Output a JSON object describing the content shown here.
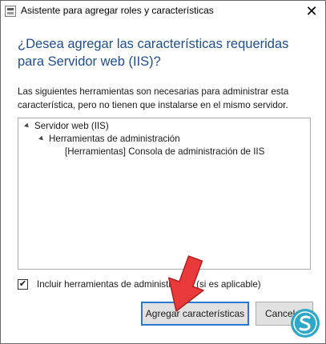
{
  "window": {
    "title": "Asistente para agregar roles y características",
    "close_glyph": "✕"
  },
  "content": {
    "heading": "¿Desea agregar las características requeridas para Servidor web (IIS)?",
    "description": "Las siguientes herramientas son necesarias para administrar esta característica, pero no tienen que instalarse en el mismo servidor."
  },
  "tree": {
    "root": "Servidor web (IIS)",
    "child": "Herramientas de administración",
    "leaf": "[Herramientas] Consola de administración de IIS"
  },
  "options": {
    "include_tools_label": "Incluir herramientas de administración (si es aplicable)",
    "include_tools_checked": true,
    "check_glyph": "✔"
  },
  "buttons": {
    "add_label": "Agregar características",
    "cancel_label": "Cancelar"
  },
  "colors": {
    "heading": "#1f4e8c",
    "arrow": "#e83a3a",
    "primary_button_border": "#2b78d0",
    "logo": "#2fa8c8"
  }
}
